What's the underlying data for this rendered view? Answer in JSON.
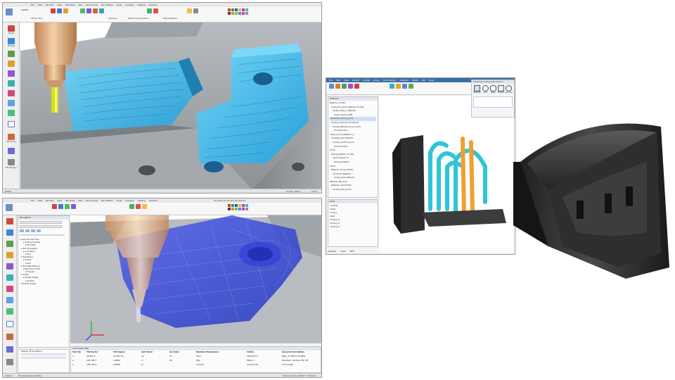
{
  "top_window": {
    "menu": [
      "File",
      "Edit",
      "NC Edit",
      "View",
      "Windows",
      "Part",
      "NC Process",
      "NC Utilities",
      "Tools",
      "Analysis",
      "Catalog",
      "Window"
    ],
    "ribbon_labels": [
      "MODEL",
      "3D NC Tool",
      "Mirror",
      "Machine",
      "Machine Simulation",
      "Rest Material",
      "Machining Solid",
      "Text",
      "Resize"
    ],
    "side_labels": [
      "Model",
      "Manage",
      "Cut",
      "Process",
      "Tools",
      "Machining",
      "NC Manager"
    ],
    "status_left": "Ready",
    "status_right": [
      "TP: NC_Setup",
      "Color"
    ]
  },
  "bottom_window": {
    "menu": [
      "File",
      "Edit",
      "NC Edit",
      "View",
      "Windows",
      "Part",
      "NC Process",
      "NC Utilities",
      "Tools",
      "Analysis",
      "Catalog",
      "Window"
    ],
    "title": "TP_Auto_5X_FA_NT_OK_Stock1",
    "panel_title": "Navigation",
    "tree_items": [
      "Load Process Files",
      "Cutting Surface",
      "Tool Path",
      "Tool Simulation",
      "Annotation",
      "Tool",
      "Workpiece",
      "Holder",
      "Part",
      "Tool Path Filtering",
      "Machine at Tool",
      "Process",
      "Cutter",
      "Holder Shape",
      "Spindle",
      "Holder Shape"
    ],
    "display_label": "Display TP Animation",
    "table_title": "Information Bar",
    "table_headers": [
      "Tool Tip",
      "Tilt Vector",
      "Tilt Angles",
      "Surf Norm",
      "Arc Data",
      "Machine Parameters",
      "Cutter",
      "General Information"
    ],
    "table_rows": [
      [
        "1",
        "96.826 X",
        "0.1787 Thi",
        "X1",
        "XY",
        "Feed",
        "200.000 F1",
        "BALL_11 MPS 0.25 NEW"
      ],
      [
        "2",
        "105.188 Y",
        "0.0826",
        "Yi",
        "XZ",
        "Spin",
        "5000 S",
        "Elevation: 30 Plane NC Toll"
      ],
      [
        "3",
        "138.144 Z",
        "0.9808",
        "Zi",
        "",
        "Coolant",
        "Coolant Off",
        "Cyrl Length",
        "0.000",
        "Block Nr"
      ]
    ],
    "status_left": [
      "Output",
      "NC Simulation Monitor"
    ],
    "status_right": "Stock: 210.4 X 86.87 Y 103.6 Z"
  },
  "right_window": {
    "menu": [
      "File",
      "Edit",
      "View",
      "Modify",
      "Create",
      "Query",
      "Mold Design",
      "Analysis",
      "Plastic",
      "NC",
      "Help"
    ],
    "dialog_title": "Conformal Cooling Cross Section",
    "dialog_options": [
      "Rectangle",
      "Circle",
      "Ellipse",
      "Triangle",
      "Tear Drop"
    ],
    "panel_title": "Features",
    "tree_items": [
      "Reflector_A1.Z01",
      "Conformal_Cavity_Reflector_A1.Z01",
      "Cavity_Cavity_1_Reflector",
      "Insert_Cavity_B_RfM",
      "Conformal_Cooling_Comp",
      "Cooling_Conformal_Conformal",
      "Cooling_Standard_Line_A1.Z01",
      "Conformal_Run",
      "Cavity_P_Conf_Reflector_A",
      "Threaded_Elec_Reflector",
      "Cooling_Conformal_Line",
      "Conformal_Run",
      "Ducts",
      "Parting_Reflector_A1.Z01",
      "Layout_Single_1V",
      "Parting_Reflector",
      "Direct",
      "Reflector_All_Ver_Holder",
      "Conformal_Reflector",
      "Cooling_Hole_Reflector",
      "Reflector_Bot_Final",
      "Reflector_Conf_Holder",
      "Cooling_Tubing_Final"
    ],
    "lower_title": "Parts",
    "lower_items": [
      "A_Cavity",
      "Cavity",
      "Cooling",
      "Insert",
      "Cooling_T1",
      "Cooling_T2",
      "Cooling_T3"
    ],
    "tabs": [
      "Explorer",
      "View",
      "Part"
    ]
  },
  "colors": {
    "toolpath_cyan": "#3fb8e6",
    "toolpath_blue": "#1d3cf0",
    "tool_copper": "#e8b888",
    "steel_gray": "#9aa0a6",
    "cooling_orange": "#f0a030",
    "cooling_cyan": "#2ec6d6",
    "part_black": "#2a2a2a"
  }
}
